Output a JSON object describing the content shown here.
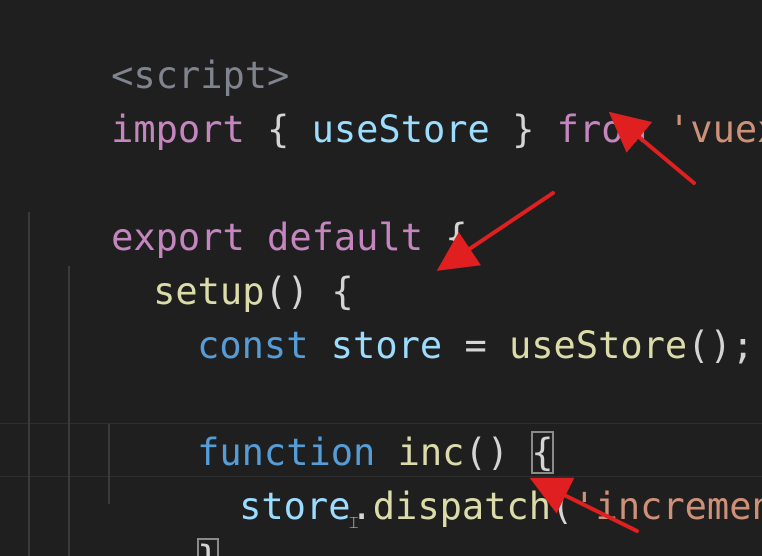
{
  "code": {
    "line1": {
      "tag": "<script>"
    },
    "line2": {
      "kw_import": "import",
      "brace_open": " { ",
      "ident": "useStore",
      "brace_close": " } ",
      "kw_from": "from",
      "space": " ",
      "module": "'vuex'",
      "semi": ";"
    },
    "line4": {
      "kw_export": "export",
      "space1": " ",
      "kw_default": "default",
      "brace": " {"
    },
    "line5": {
      "fn_setup": "setup",
      "rest": "() {"
    },
    "line6": {
      "kw_const": "const",
      "space": " ",
      "var_store": "store",
      "eq": " = ",
      "fn_call": "useStore",
      "rest": "();"
    },
    "line8": {
      "kw_function": "function",
      "space": " ",
      "fn_inc": "inc",
      "parens": "() ",
      "brace": "{"
    },
    "line9": {
      "var_store": "store",
      "dot": ".",
      "fn_dispatch": "dispatch",
      "paren_open": "(",
      "arg": "'increment'",
      "rest": ");"
    },
    "line10": {
      "brace": "}"
    }
  },
  "colors": {
    "background": "#1f1f1f",
    "annotation_arrow": "#e02020"
  },
  "icons": {
    "text_cursor": "ibeam-cursor-icon"
  }
}
